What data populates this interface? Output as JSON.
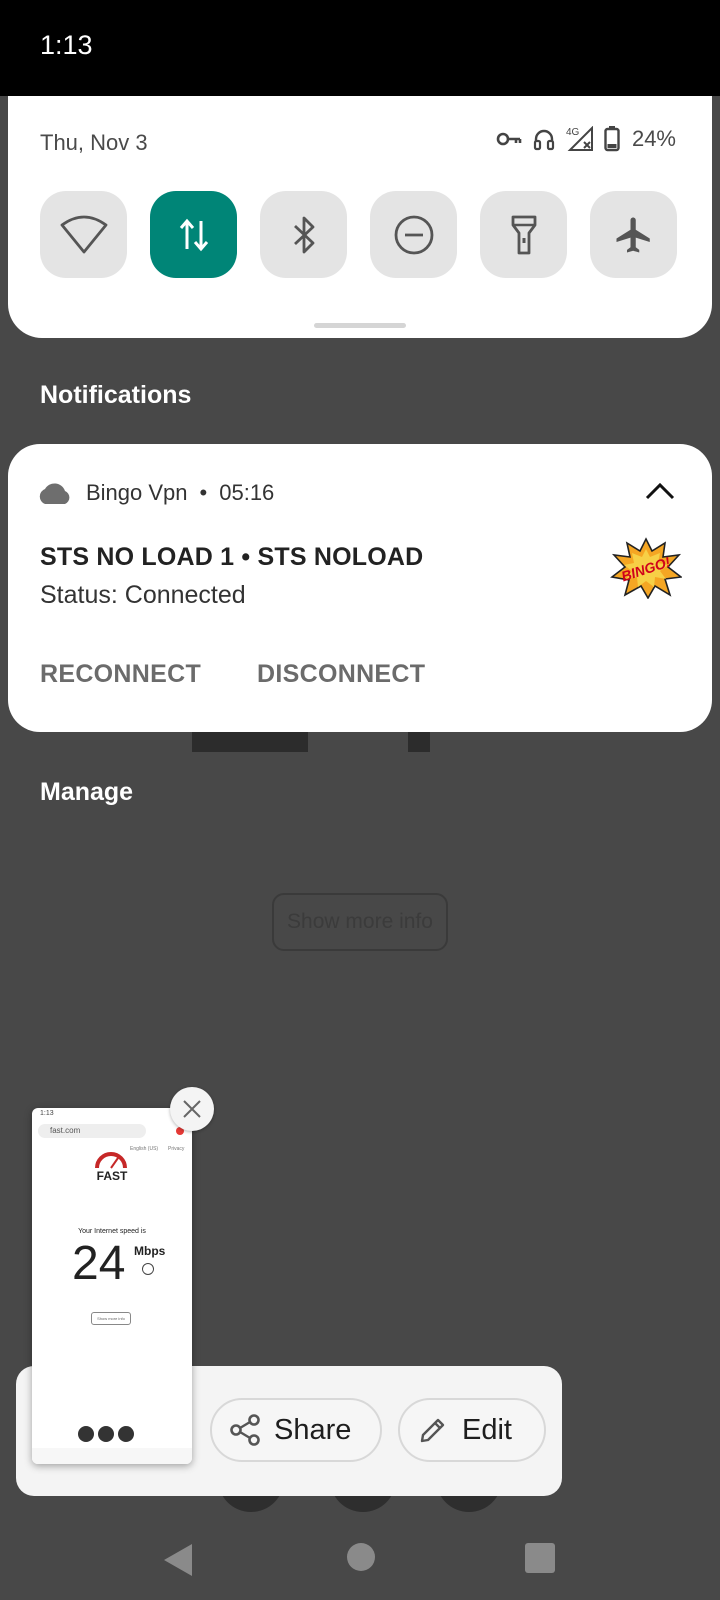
{
  "status_bar": {
    "time": "1:13"
  },
  "quick_settings": {
    "date": "Thu, Nov 3",
    "battery_level": "24%",
    "network_label": "4G",
    "tiles": [
      {
        "name": "wifi",
        "on": false
      },
      {
        "name": "mobile-data",
        "on": true
      },
      {
        "name": "bluetooth",
        "on": false
      },
      {
        "name": "do-not-disturb",
        "on": false
      },
      {
        "name": "flashlight",
        "on": false
      },
      {
        "name": "airplane-mode",
        "on": false
      }
    ],
    "accent_color": "#008577"
  },
  "sections": {
    "notifications": "Notifications",
    "manage": "Manage"
  },
  "notification": {
    "app_name": "Bingo Vpn",
    "separator": "•",
    "time": "05:16",
    "title": "STS NO LOAD 1 • STS NOLOAD",
    "text": "Status: Connected",
    "logo_text": "BINGO!",
    "actions": [
      "RECONNECT",
      "DISCONNECT"
    ]
  },
  "background_app": {
    "button_label": "Show more info"
  },
  "screenshot_preview": {
    "share_label": "Share",
    "edit_label": "Edit",
    "thumbnail": {
      "time": "1:13",
      "url": "fast.com",
      "lang": "English (US)",
      "policy": "Privacy",
      "logo": "FAST",
      "caption": "Your Internet speed is",
      "speed_value": "24",
      "speed_unit": "Mbps",
      "more_info": "Show more info"
    }
  }
}
